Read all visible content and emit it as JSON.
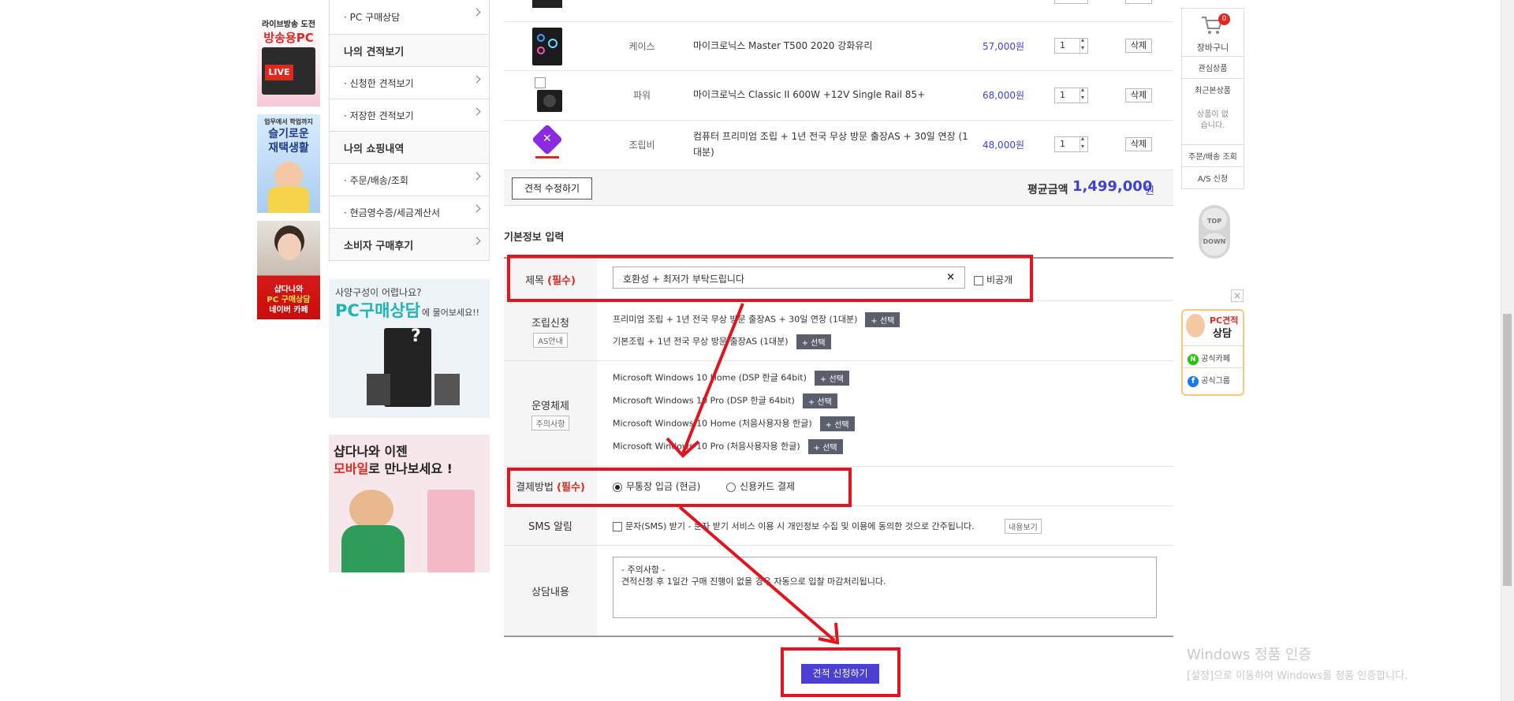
{
  "left_banners": {
    "b1_line1": "라이브방송 도전",
    "b1_line2": "방송용PC",
    "b1_tag": "LIVE",
    "b2_line1": "업무에서 학업까지",
    "b2_line2": "슬기로운",
    "b2_line3": "재택생활",
    "b3_line1": "샵다나와",
    "b3_line2": "PC 구매상담",
    "b3_line3": "네이버 카페"
  },
  "sidebar": {
    "items": [
      {
        "label": "· PC 구매상담",
        "head": false
      },
      {
        "label": "나의 견적보기",
        "head": true
      },
      {
        "label": "· 신청한 견적보기",
        "head": false
      },
      {
        "label": "· 저장한 견적보기",
        "head": false
      },
      {
        "label": "나의 쇼핑내역",
        "head": true
      },
      {
        "label": "· 주문/배송/조회",
        "head": false
      },
      {
        "label": "· 현금영수증/세금계산서",
        "head": false
      },
      {
        "label": "소비자 구매후기",
        "head": true
      }
    ],
    "ad1": {
      "line1": "사양구성이 어렵나요?",
      "line2": "PC구매상담",
      "line3": "에 물어보세요!!"
    },
    "ad2": {
      "line1": "샵다나와 이젠",
      "line2_a": "모바일",
      "line2_b": "로 만나보세요 !"
    }
  },
  "products": [
    {
      "category": "케이스",
      "name": "마이크로닉스 Master T500 2020 강화유리",
      "price": "57,000원",
      "qty": "1",
      "delete": "삭제"
    },
    {
      "category": "파워",
      "name": "마이크로닉스 Classic II 600W +12V Single Rail 85+",
      "price": "68,000원",
      "qty": "1",
      "delete": "삭제"
    },
    {
      "category": "조립비",
      "name": "컴퓨터 프리미엄 조립 + 1년 전국 무상 방문 출장AS + 30일 연장 (1대분)",
      "price": "48,000원",
      "qty": "1",
      "delete": "삭제"
    }
  ],
  "summary": {
    "edit_button": "견적 수정하기",
    "total_label": "평균금액",
    "total_value": "1,499,000",
    "total_unit": "원"
  },
  "form": {
    "section_title": "기본정보 입력",
    "title_label": "제목",
    "required_mark": "(필수)",
    "title_value": "호환성 + 최저가 부탁드립니다",
    "clear_icon": "×",
    "private_label": "비공개",
    "assembly_label": "조립신청",
    "assembly_info_button": "AS안내",
    "assembly_options": [
      "프리미엄 조립 + 1년 전국 무상 방문 출장AS + 30일 연장 (1대분)",
      "기본조립 + 1년 전국 무상 방문 출장AS (1대분)"
    ],
    "select_button": "+ 선택",
    "os_label": "운영체제",
    "os_notice_button": "주의사항",
    "os_options": [
      "Microsoft Windows 10 Home (DSP 한글 64bit)",
      "Microsoft Windows 10 Pro (DSP 한글 64bit)",
      "Microsoft Windows 10 Home (처음사용자용 한글)",
      "Microsoft Windows 10 Pro (처음사용자용 한글)"
    ],
    "payment_label": "결제방법",
    "payment_options": [
      "무통장 입금 (현금)",
      "신용카드 결제"
    ],
    "sms_label": "SMS 알림",
    "sms_text": "문자(SMS) 받기 - 문자 받기 서비스 이용 시 개인정보 수집 및 이용에 동의한 것으로 간주됩니다.",
    "sms_more_button": "내용보기",
    "consult_label": "상담내용",
    "consult_line1": "- 주의사항 -",
    "consult_line2": "견적신청 후 1일간 구매 진행이 없을 경우 자동으로 입찰 마감처리됩니다.",
    "submit_button": "견적 신청하기"
  },
  "quick_panel": {
    "cart_label": "장바구니",
    "cart_count": "0",
    "items": [
      "관심상품",
      "최근본상품"
    ],
    "recent_empty": "상품이 없습니다.",
    "items2": [
      "주문/배송 조회",
      "A/S 신청"
    ],
    "top": "TOP",
    "down": "DOWN",
    "consult_title1": "PC견적",
    "consult_title2": "상담",
    "cafe": "공식카페",
    "group": "공식그룹"
  },
  "watermark": {
    "line1": "Windows 정품 인증",
    "line2": "[설정]으로 이동하여 Windows를 정품 인증합니다."
  },
  "colors": {
    "accent_blue": "#3f3fd9",
    "submit": "#4b3fd6",
    "annotation_red": "#e5131e",
    "required_red": "#e0281f"
  }
}
